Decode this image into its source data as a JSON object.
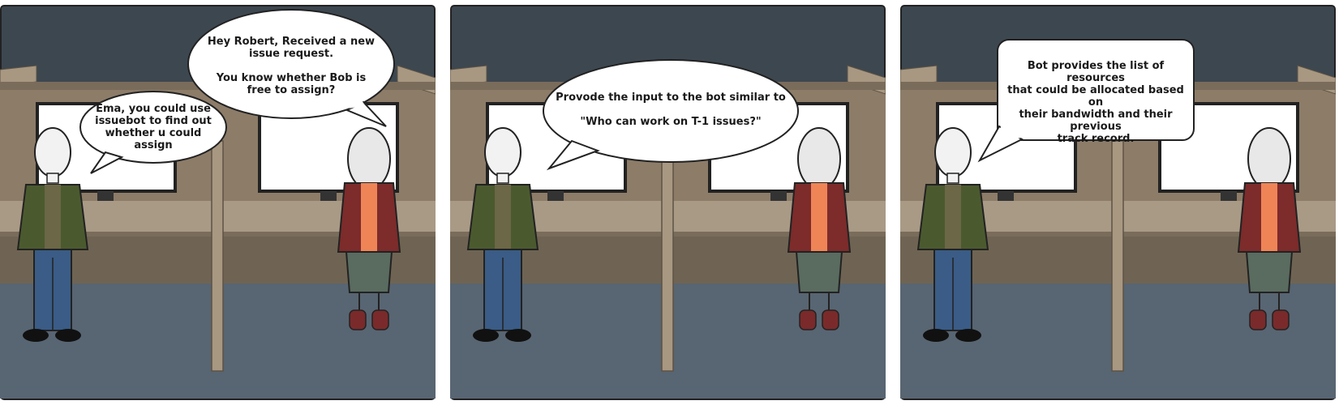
{
  "panels": [
    {
      "bubbles": [
        {
          "lines": [
            "Hey Robert, Received a new",
            "issue request.",
            "",
            "You know whether Bob is",
            "free to assign?"
          ]
        },
        {
          "lines": [
            "Ema, you could use",
            "issuebot to find out",
            "whether u could",
            "assign"
          ]
        }
      ]
    },
    {
      "bubbles": [
        {
          "lines": [
            "Provode the input to the bot similar to",
            "",
            "\"Who can work on T-1 issues?\""
          ]
        }
      ]
    },
    {
      "bubbles": [
        {
          "lines": [
            "Bot provides the list of resources",
            "that could be allocated based on",
            "their bandwidth and their previous",
            "track record."
          ]
        }
      ]
    }
  ],
  "colors": {
    "sky": "#3d4750",
    "wall": "#8c7c68",
    "floor": "#586572",
    "desk": "#a99a86",
    "man_jacket": "#4b5a2e",
    "man_pants": "#3a5c86",
    "woman_jacket": "#7d2b2b",
    "woman_shirt": "#ef8456",
    "woman_skirt": "#5a6b60",
    "boots": "#7a2a2a"
  },
  "icons": [
    "man-character-icon",
    "woman-character-icon",
    "monitor-icon",
    "speech-bubble-icon"
  ]
}
